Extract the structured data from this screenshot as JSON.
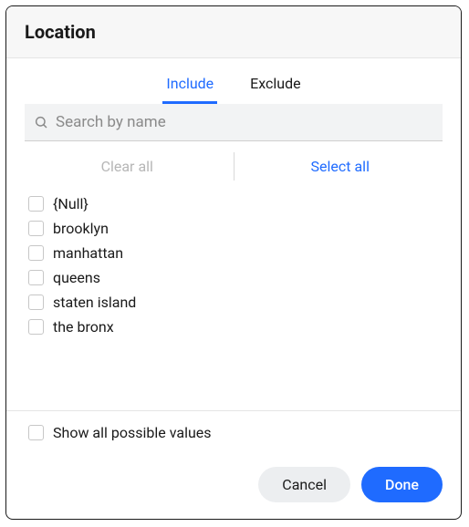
{
  "header": {
    "title": "Location"
  },
  "tabs": {
    "include": "Include",
    "exclude": "Exclude",
    "active": "include"
  },
  "search": {
    "placeholder": "Search by name",
    "value": ""
  },
  "bulk": {
    "clear": "Clear all",
    "select": "Select all"
  },
  "items": [
    {
      "label": "{Null}"
    },
    {
      "label": "brooklyn"
    },
    {
      "label": "manhattan"
    },
    {
      "label": "queens"
    },
    {
      "label": "staten island"
    },
    {
      "label": "the bronx"
    }
  ],
  "show_all": {
    "label": "Show all possible values"
  },
  "footer": {
    "cancel": "Cancel",
    "done": "Done"
  },
  "colors": {
    "accent": "#1f6bff",
    "muted": "#b6b6b6"
  }
}
